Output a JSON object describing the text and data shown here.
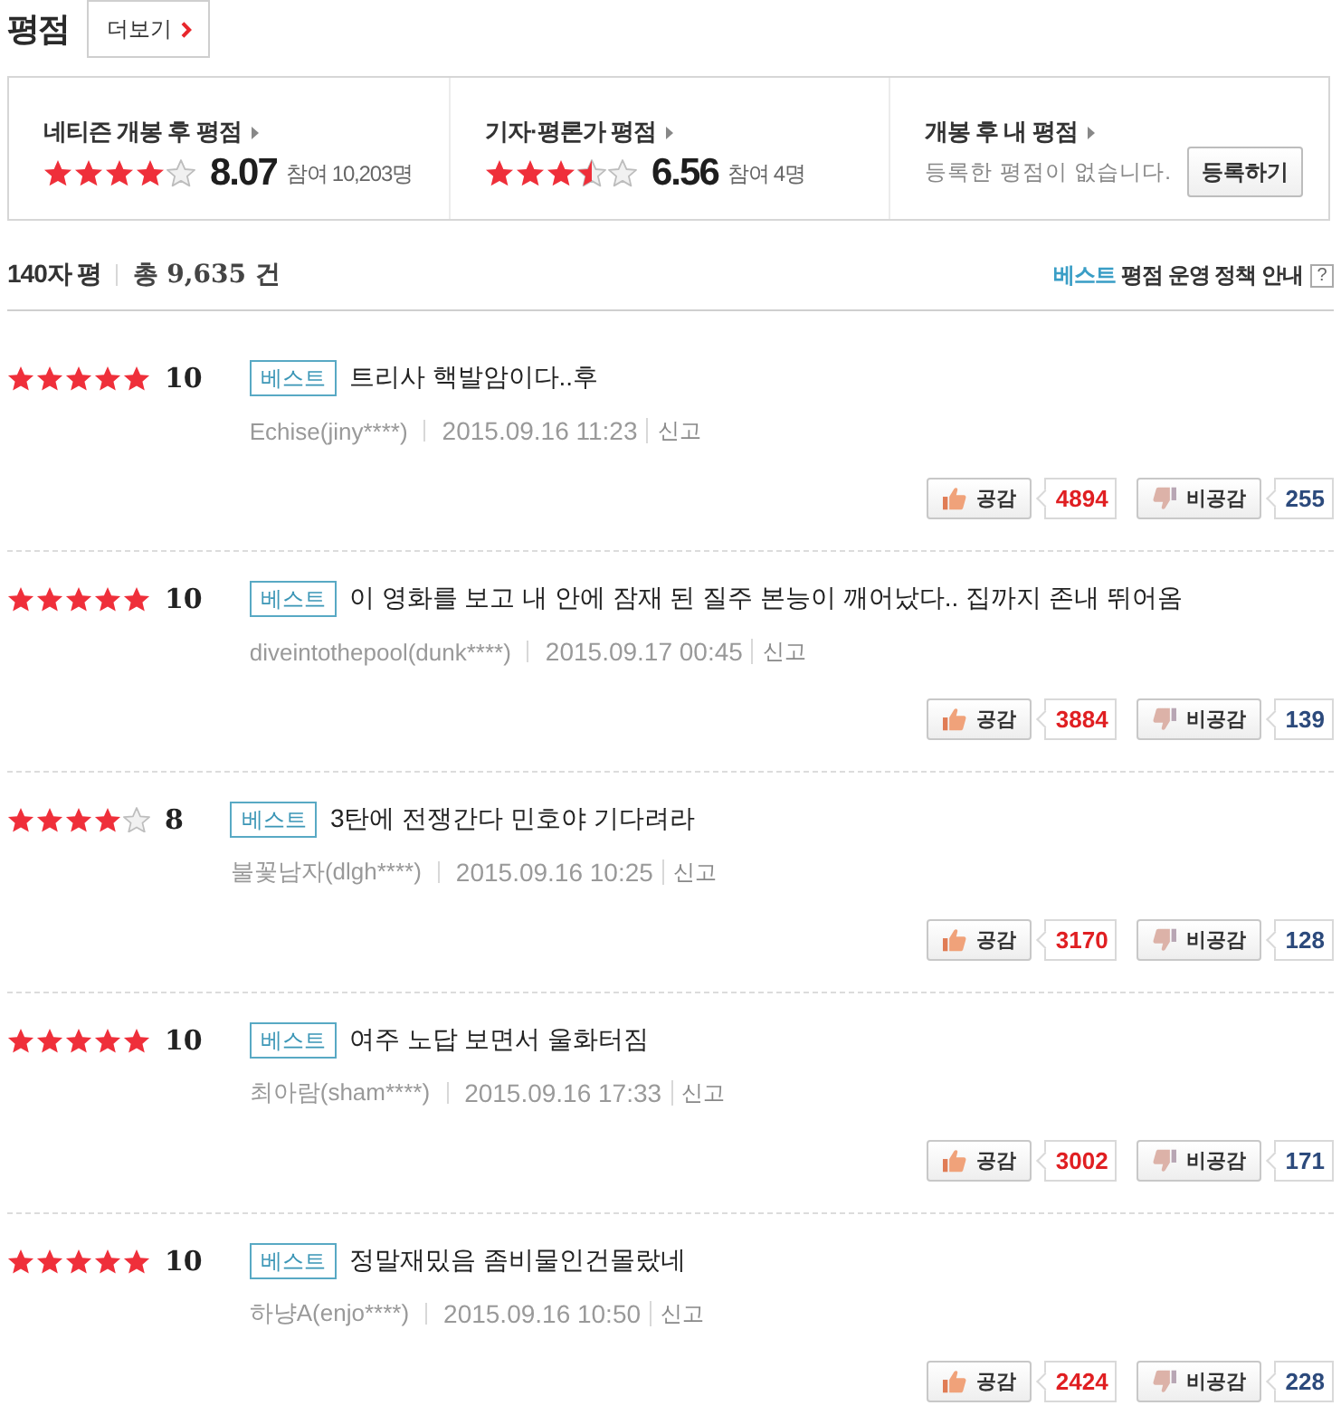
{
  "header": {
    "title": "평점",
    "more_button": "더보기"
  },
  "summary": [
    {
      "kind": "score",
      "title": "네티즌 개봉 후 평점",
      "stars": 4,
      "score": "8.07",
      "participants": "참여 10,203명"
    },
    {
      "kind": "score",
      "title": "기자·평론가 평점",
      "stars": 3.5,
      "score": "6.56",
      "participants": "참여 4명"
    },
    {
      "kind": "mine",
      "title": "개봉 후 내 평점",
      "message": "등록한 평점이 없습니다.",
      "button": "등록하기"
    }
  ],
  "list_header": {
    "label": "140자 평",
    "total": "총 9,635 건",
    "policy_highlight": "베스트",
    "policy_text": "평점 운영 정책 안내",
    "help": "?"
  },
  "reviews": [
    {
      "stars": 5,
      "score": "10",
      "badge": "베스트",
      "text": "트리사 핵발암이다..후",
      "author": "Echise(jiny****)",
      "date": "2015.09.16 11:23",
      "report": "신고",
      "like_label": "공감",
      "likes": "4894",
      "dislike_label": "비공감",
      "dislikes": "255"
    },
    {
      "stars": 5,
      "score": "10",
      "badge": "베스트",
      "text": "이 영화를 보고 내 안에 잠재 된 질주 본능이 깨어났다.. 집까지 존내 뛰어옴",
      "author": "diveintothepool(dunk****)",
      "date": "2015.09.17 00:45",
      "report": "신고",
      "like_label": "공감",
      "likes": "3884",
      "dislike_label": "비공감",
      "dislikes": "139"
    },
    {
      "stars": 4,
      "score": "8",
      "badge": "베스트",
      "text": "3탄에 전쟁간다 민호야 기다려라",
      "author": "불꽃남자(dlgh****)",
      "date": "2015.09.16 10:25",
      "report": "신고",
      "like_label": "공감",
      "likes": "3170",
      "dislike_label": "비공감",
      "dislikes": "128"
    },
    {
      "stars": 5,
      "score": "10",
      "badge": "베스트",
      "text": "여주 노답 보면서 울화터짐",
      "author": "최아람(sham****)",
      "date": "2015.09.16 17:33",
      "report": "신고",
      "like_label": "공감",
      "likes": "3002",
      "dislike_label": "비공감",
      "dislikes": "171"
    },
    {
      "stars": 5,
      "score": "10",
      "badge": "베스트",
      "text": "정말재밌음 좀비물인건몰랐네",
      "author": "하냥A(enjo****)",
      "date": "2015.09.16 10:50",
      "report": "신고",
      "like_label": "공감",
      "likes": "2424",
      "dislike_label": "비공감",
      "dislikes": "228"
    }
  ]
}
